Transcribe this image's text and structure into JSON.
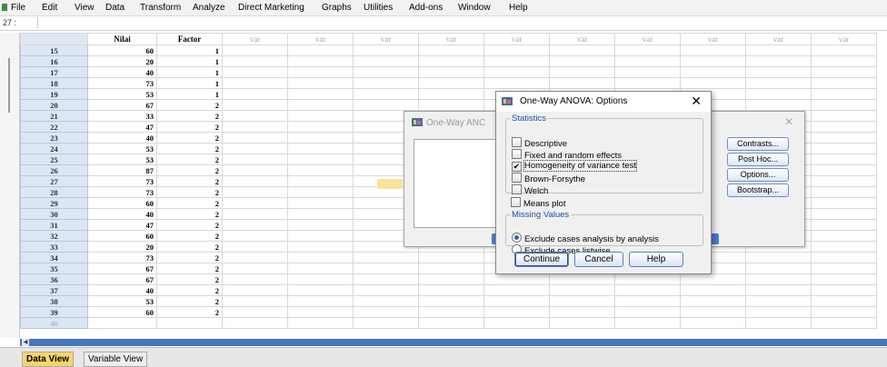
{
  "menu": [
    "File",
    "Edit",
    "View",
    "Data",
    "Transform",
    "Analyze",
    "Direct Marketing",
    "Graphs",
    "Utilities",
    "Add-ons",
    "Window",
    "Help"
  ],
  "cell_ref": "27 :",
  "columns": {
    "c1": "Nilai",
    "c2": "Factor",
    "var": "var"
  },
  "rows": [
    {
      "n": "15",
      "nilai": "60",
      "factor": "1"
    },
    {
      "n": "16",
      "nilai": "20",
      "factor": "1"
    },
    {
      "n": "17",
      "nilai": "40",
      "factor": "1"
    },
    {
      "n": "18",
      "nilai": "73",
      "factor": "1"
    },
    {
      "n": "19",
      "nilai": "53",
      "factor": "1"
    },
    {
      "n": "20",
      "nilai": "67",
      "factor": "2"
    },
    {
      "n": "21",
      "nilai": "33",
      "factor": "2"
    },
    {
      "n": "22",
      "nilai": "47",
      "factor": "2"
    },
    {
      "n": "23",
      "nilai": "40",
      "factor": "2"
    },
    {
      "n": "24",
      "nilai": "53",
      "factor": "2"
    },
    {
      "n": "25",
      "nilai": "53",
      "factor": "2"
    },
    {
      "n": "26",
      "nilai": "87",
      "factor": "2"
    },
    {
      "n": "27",
      "nilai": "73",
      "factor": "2"
    },
    {
      "n": "28",
      "nilai": "73",
      "factor": "2"
    },
    {
      "n": "29",
      "nilai": "60",
      "factor": "2"
    },
    {
      "n": "30",
      "nilai": "40",
      "factor": "2"
    },
    {
      "n": "31",
      "nilai": "47",
      "factor": "2"
    },
    {
      "n": "32",
      "nilai": "60",
      "factor": "2"
    },
    {
      "n": "33",
      "nilai": "20",
      "factor": "2"
    },
    {
      "n": "34",
      "nilai": "73",
      "factor": "2"
    },
    {
      "n": "35",
      "nilai": "67",
      "factor": "2"
    },
    {
      "n": "36",
      "nilai": "67",
      "factor": "2"
    },
    {
      "n": "37",
      "nilai": "40",
      "factor": "2"
    },
    {
      "n": "38",
      "nilai": "53",
      "factor": "2"
    },
    {
      "n": "39",
      "nilai": "60",
      "factor": "2"
    },
    {
      "n": "40",
      "nilai": "",
      "factor": ""
    }
  ],
  "tabs": {
    "data_view": "Data View",
    "variable_view": "Variable View"
  },
  "bg_dialog": {
    "title": "One-Way ANC",
    "buttons": {
      "contrasts": "Contrasts...",
      "posthoc": "Post Hoc...",
      "options": "Options...",
      "bootstrap": "Bootstrap..."
    }
  },
  "dialog": {
    "title": "One-Way ANOVA: Options",
    "statistics_legend": "Statistics",
    "options": [
      {
        "label": "Descriptive",
        "checked": false
      },
      {
        "label": "Fixed and random effects",
        "checked": false
      },
      {
        "label": "Homogeneity of variance test",
        "checked": true
      },
      {
        "label": "Brown-Forsythe",
        "checked": false
      },
      {
        "label": "Welch",
        "checked": false
      }
    ],
    "means_plot": "Means plot",
    "missing_legend": "Missing Values",
    "missing": [
      {
        "label": "Exclude cases analysis by analysis",
        "selected": true
      },
      {
        "label": "Exclude cases listwise",
        "selected": false
      }
    ],
    "buttons": {
      "continue": "Continue",
      "cancel": "Cancel",
      "help": "Help"
    }
  },
  "colors": {
    "row_header": "#dde6f3",
    "scrollbar": "#4577c0",
    "active_tab": "#f7d66b"
  }
}
